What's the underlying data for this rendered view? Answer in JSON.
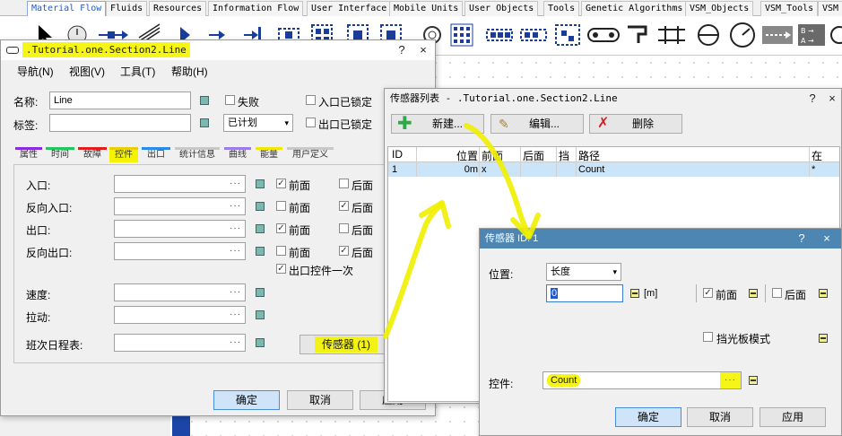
{
  "toolbox": {
    "tabs": [
      "Material Flow",
      "Fluids",
      "Resources",
      "Information Flow",
      "User Interface",
      "Mobile Units",
      "User Objects",
      "Tools",
      "Genetic Algorithms",
      "VSM_Objects",
      "VSM_Tools",
      "VSM"
    ],
    "active_tab": "Material Flow"
  },
  "line_dialog": {
    "title": ".Tutorial.one.Section2.Line",
    "menu": [
      "导航(N)",
      "视图(V)",
      "工具(T)",
      "帮助(H)"
    ],
    "name_label": "名称:",
    "name_value": "Line",
    "tag_label": "标签:",
    "tag_value": "",
    "failed_label": "失败",
    "plan_value": "已计划",
    "entrance_locked": "入口已锁定",
    "exit_locked": "出口已锁定",
    "tabs": [
      {
        "label": "属性",
        "color": "#8a2be2"
      },
      {
        "label": "时间",
        "color": "#22c55e"
      },
      {
        "label": "故障",
        "color": "#e11d1d"
      },
      {
        "label": "控件",
        "color": "#e8d000"
      },
      {
        "label": "出口",
        "color": "#2b8be8"
      },
      {
        "label": "统计信息",
        "color": "#c8c8c8"
      },
      {
        "label": "曲线",
        "color": "#9a7de8"
      },
      {
        "label": "能量",
        "color": "#f0e800"
      },
      {
        "label": "用户定义",
        "color": "#c8c8c8"
      }
    ],
    "active_tab": "控件",
    "controls": [
      {
        "label": "入口:",
        "value": "",
        "front": true,
        "back": false
      },
      {
        "label": "反向入口:",
        "value": "",
        "front": false,
        "back": true
      },
      {
        "label": "出口:",
        "value": "",
        "front": true,
        "back": false
      },
      {
        "label": "反向出口:",
        "value": "",
        "front": false,
        "back": true
      }
    ],
    "front_label": "前面",
    "back_label": "后面",
    "exit_once_label": "出口控件一次",
    "speed_label": "速度:",
    "drag_label": "拉动:",
    "shift_label": "班次日程表:",
    "sensor_button": "传感器 (1)",
    "ok": "确定",
    "cancel": "取消",
    "apply": "应用",
    "help": "?",
    "close": "×"
  },
  "sensor_list": {
    "title": "传感器列表 - .Tutorial.one.Section2.Line",
    "new_button": "新建...",
    "edit_button": "编辑...",
    "delete_button": "删除",
    "columns": [
      "ID",
      "位置",
      "前面",
      "后面",
      "挡",
      "路径",
      "在"
    ],
    "rows": [
      {
        "id": "1",
        "position": "0m",
        "front": "x",
        "back": "",
        "stop": "",
        "path": "Count",
        "at": "*"
      }
    ]
  },
  "sensor_dialog": {
    "title": "传感器 ID: 1",
    "position_label": "位置:",
    "position_mode": "长度",
    "position_value": "0",
    "unit": "[m]",
    "front_label": "前面",
    "back_label": "后面",
    "barrier_label": "挡光板模式",
    "control_label": "控件:",
    "control_value": "Count",
    "ok": "确定",
    "cancel": "取消",
    "apply": "应用"
  }
}
